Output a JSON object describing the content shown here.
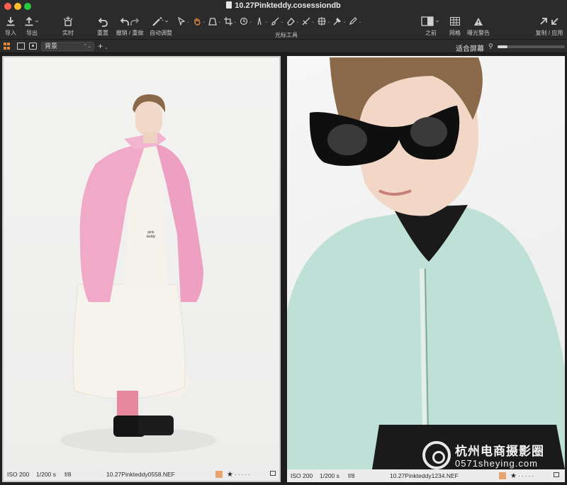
{
  "window": {
    "title": "10.27Pinkteddy.cosessiondb"
  },
  "toolbar": {
    "import_label": "导入",
    "export_label": "导出",
    "live_label": "实时",
    "reset_label": "重置",
    "undo_redo_label": "撤销 / 重做",
    "auto_adjust_label": "自动调整",
    "cursor_tools_label": "光标工具",
    "before_label": "之前",
    "grid_label": "网格",
    "exposure_warning_label": "曝光警告",
    "copy_apply_label": "复制 / 应用"
  },
  "subbar": {
    "layer_select": "背景",
    "fit_label": "适合屏幕",
    "zoom_level": 0.05
  },
  "viewer": {
    "left": {
      "iso": "ISO 200",
      "shutter": "1/200 s",
      "aperture": "f/8",
      "filename": "10.27Pinkteddy0558.NEF",
      "color_tag": "#e9a46f",
      "rating": 1
    },
    "right": {
      "iso": "ISO 200",
      "shutter": "1/200 s",
      "aperture": "f/8",
      "filename": "10.27Pinkteddy1234.NEF",
      "color_tag": "#e9a46f",
      "rating": 1
    }
  },
  "watermark": {
    "line1": "杭州电商摄影圈",
    "line2": "0571sheying.com"
  },
  "photo_text": {
    "label": "pink\nteddy"
  }
}
